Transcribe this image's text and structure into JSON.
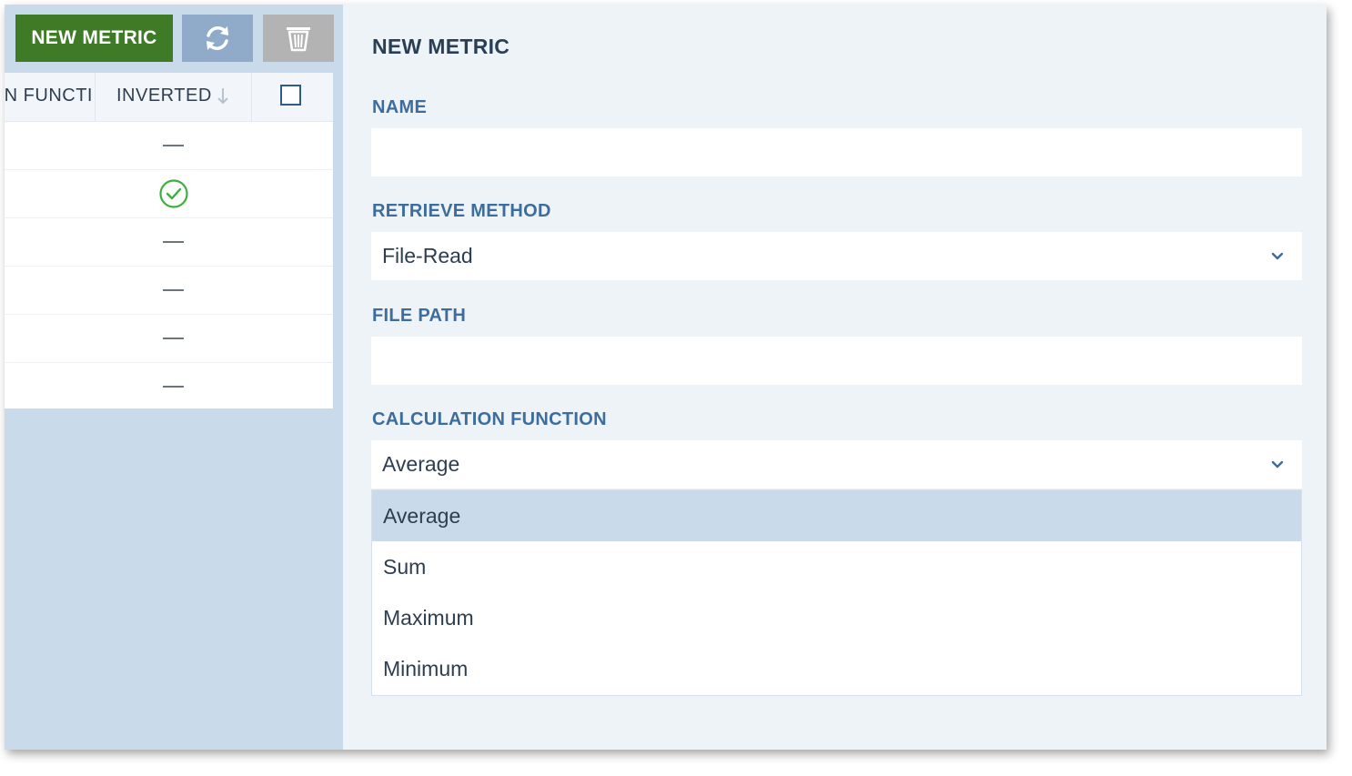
{
  "toolbar": {
    "new_metric_label": "NEW METRIC"
  },
  "grid": {
    "columns": {
      "function_partial": "N FUNCTI",
      "inverted": "INVERTED"
    },
    "rows": [
      {
        "inverted": false
      },
      {
        "inverted": true
      },
      {
        "inverted": false
      },
      {
        "inverted": false
      },
      {
        "inverted": false
      },
      {
        "inverted": false
      }
    ]
  },
  "panel": {
    "title": "NEW METRIC",
    "name": {
      "label": "NAME",
      "value": ""
    },
    "retrieve": {
      "label": "RETRIEVE METHOD",
      "value": "File-Read"
    },
    "file_path": {
      "label": "FILE PATH",
      "value": ""
    },
    "calc": {
      "label": "CALCULATION FUNCTION",
      "value": "Average",
      "options": [
        "Average",
        "Sum",
        "Maximum",
        "Minimum"
      ],
      "highlighted_option": "Average"
    }
  },
  "icons": {
    "refresh": "refresh-icon",
    "delete": "trash-icon",
    "sort": "arrow-down-icon",
    "check": "check-circle-icon",
    "chevron": "chevron-down-icon"
  },
  "colors": {
    "new_metric_button": "#3f7a26",
    "refresh_button": "#8fabc9",
    "delete_button": "#b3b3b3",
    "label_blue": "#3d6d9c",
    "check_green": "#3fae3f",
    "highlight": "#c9dbeb"
  }
}
